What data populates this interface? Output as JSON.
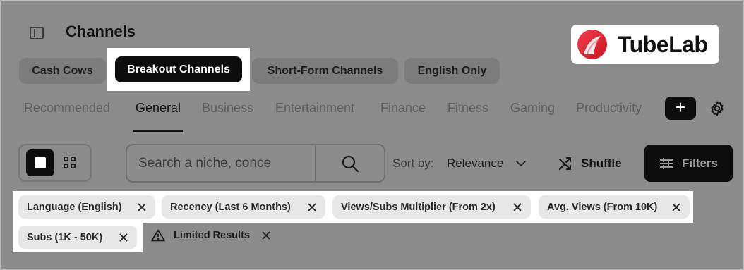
{
  "header": {
    "title": "Channels"
  },
  "brand": {
    "name": "TubeLab",
    "accent": "#e8283a"
  },
  "collections": [
    {
      "label": "Cash Cows",
      "active": false
    },
    {
      "label": "Breakout Channels",
      "active": true
    },
    {
      "label": "Short-Form Channels",
      "active": false
    },
    {
      "label": "English Only",
      "active": false
    }
  ],
  "tabs": [
    {
      "label": "Recommended"
    },
    {
      "label": "General",
      "active": true
    },
    {
      "label": "Business"
    },
    {
      "label": "Entertainment"
    },
    {
      "label": "Finance"
    },
    {
      "label": "Fitness"
    },
    {
      "label": "Gaming"
    },
    {
      "label": "Productivity"
    }
  ],
  "add_button": {
    "label": "+"
  },
  "search": {
    "placeholder": "Search a niche, conce"
  },
  "sort": {
    "label": "Sort by:",
    "value": "Relevance"
  },
  "shuffle": {
    "label": "Shuffle"
  },
  "filters_button": {
    "label": "Filters"
  },
  "active_filters": [
    {
      "label": "Language (English)"
    },
    {
      "label": "Recency (Last 6 Months)"
    },
    {
      "label": "Views/Subs Multiplier (From 2x)"
    },
    {
      "label": "Avg. Views (From 10K)"
    },
    {
      "label": "Subs (1K - 50K)"
    }
  ],
  "notice": {
    "label": "Limited Results"
  }
}
